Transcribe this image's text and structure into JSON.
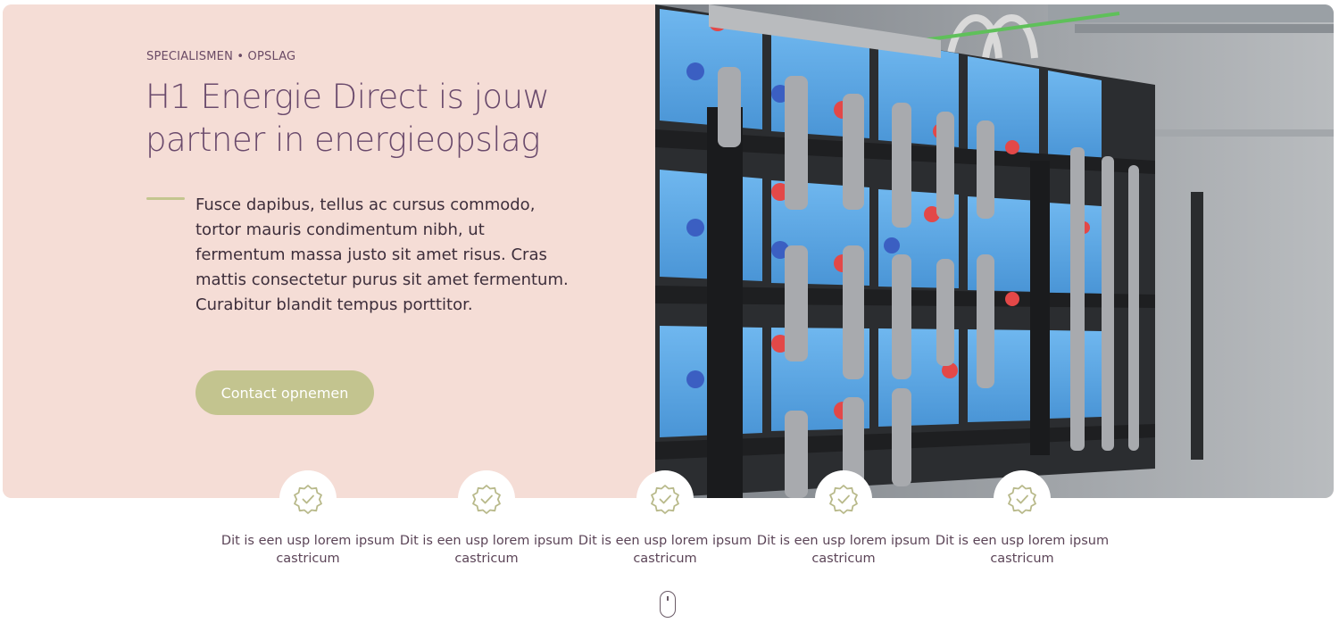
{
  "hero": {
    "eyebrow": "SPECIALISMEN • OPSLAG",
    "title": "H1 Energie Direct is jouw partner in energieopslag",
    "body": "Fusce dapibus, tellus ac cursus commodo, tortor mauris condimentum nibh, ut fermentum massa justo sit amet risus. Cras mattis consectetur purus sit amet fermentum. Curabitur blandit tempus porttitor.",
    "cta_label": "Contact opnemen"
  },
  "usps": [
    {
      "text": "Dit is een usp lorem ipsum castricum",
      "icon": "badge-check-icon"
    },
    {
      "text": "Dit is een usp lorem ipsum castricum",
      "icon": "badge-check-icon"
    },
    {
      "text": "Dit is een usp lorem ipsum castricum",
      "icon": "badge-check-icon"
    },
    {
      "text": "Dit is een usp lorem ipsum castricum",
      "icon": "badge-check-icon"
    },
    {
      "text": "Dit is een usp lorem ipsum castricum",
      "icon": "badge-check-icon"
    }
  ],
  "colors": {
    "hero_bg": "#f5ddd6",
    "title": "#6a4a6c",
    "accent_green": "#c3c48f",
    "battery_blue": "#5aa7e6"
  },
  "scroll_indicator": "mouse-scroll-icon"
}
